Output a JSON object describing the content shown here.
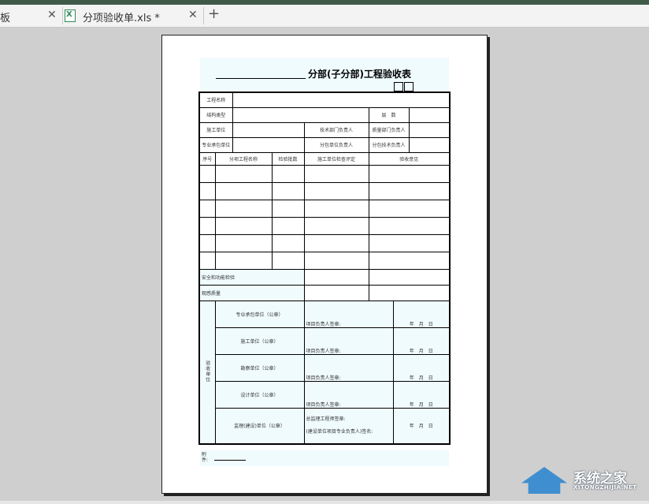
{
  "tabs": [
    {
      "label": "板",
      "close": "✕"
    },
    {
      "label": "分项验收单.xls *",
      "close": "✕",
      "icon": "excel-file-icon"
    }
  ],
  "new_tab": "+",
  "doc": {
    "title": "分部(子分部)工程验收表",
    "rows": {
      "project_name": "工程名称",
      "structure_type": "结构类型",
      "floors": "层　数",
      "construction_unit": "施工单位",
      "tech_dept_head": "技术部门负责人",
      "quality_dept_head": "质量部门负责人",
      "sub_contractor": "专业承包单位",
      "sub_unit_head": "分包单位负责人",
      "sub_tech_head": "分包技术负责人"
    },
    "headers": [
      "序号",
      "分项工程名称",
      "检验批数",
      "施工单位检查评定",
      "验收意见"
    ],
    "safety": "安全和功能检验",
    "appearance": "观感质量",
    "acceptance_label": "验收单位",
    "units": [
      "专业承包单位（公章）",
      "施工单位（公章）",
      "勘察单位（公章）",
      "设计单位（公章）",
      "监理(建设)单位（公章）"
    ],
    "sig_label": "项目负责人签章:",
    "ymd": "年　月　日",
    "supervisor_sig": "总监理工程师签章:",
    "owner_sig": "(建设单位项目专业负责人)签名:",
    "attachment": "附件:"
  },
  "watermark": {
    "name": "系统之家",
    "url": "XITONGZHIJIA.NET"
  },
  "colors": {
    "accent_green": "#3f5a49",
    "cell_tint": "#f0fbfd",
    "logo_blue": "#2f86cf"
  }
}
